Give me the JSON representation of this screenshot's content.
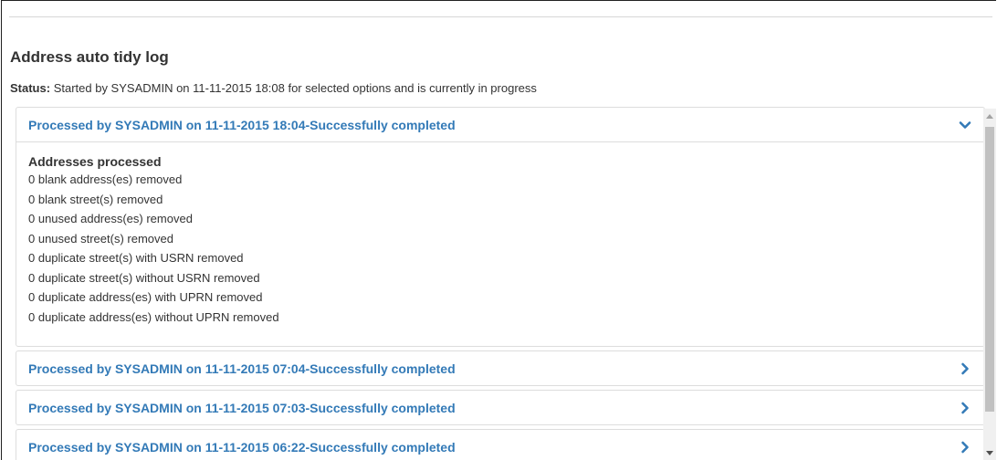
{
  "page": {
    "title": "Address auto tidy log",
    "status_label": "Status:",
    "status_text": "Started by SYSADMIN on 11-11-2015 18:08 for selected options and is currently in progress"
  },
  "panels": [
    {
      "title": "Processed by SYSADMIN on 11-11-2015 18:04-Successfully completed",
      "expanded": true,
      "icon": "chevron-down-icon",
      "body_title": "Addresses processed",
      "lines": [
        "0 blank address(es) removed",
        "0 blank street(s) removed",
        "0 unused address(es) removed",
        "0 unused street(s) removed",
        "0 duplicate street(s) with USRN removed",
        "0 duplicate street(s) without USRN removed",
        "0 duplicate address(es) with UPRN removed",
        "0 duplicate address(es) without UPRN removed"
      ]
    },
    {
      "title": "Processed by SYSADMIN on 11-11-2015 07:04-Successfully completed",
      "expanded": false,
      "icon": "chevron-right-icon"
    },
    {
      "title": "Processed by SYSADMIN on 11-11-2015 07:03-Successfully completed",
      "expanded": false,
      "icon": "chevron-right-icon"
    },
    {
      "title": "Processed by SYSADMIN on 11-11-2015 06:22-Successfully completed",
      "expanded": false,
      "icon": "chevron-right-icon"
    }
  ],
  "colors": {
    "link": "#337ab7",
    "text": "#333333",
    "border": "#dddddd"
  }
}
